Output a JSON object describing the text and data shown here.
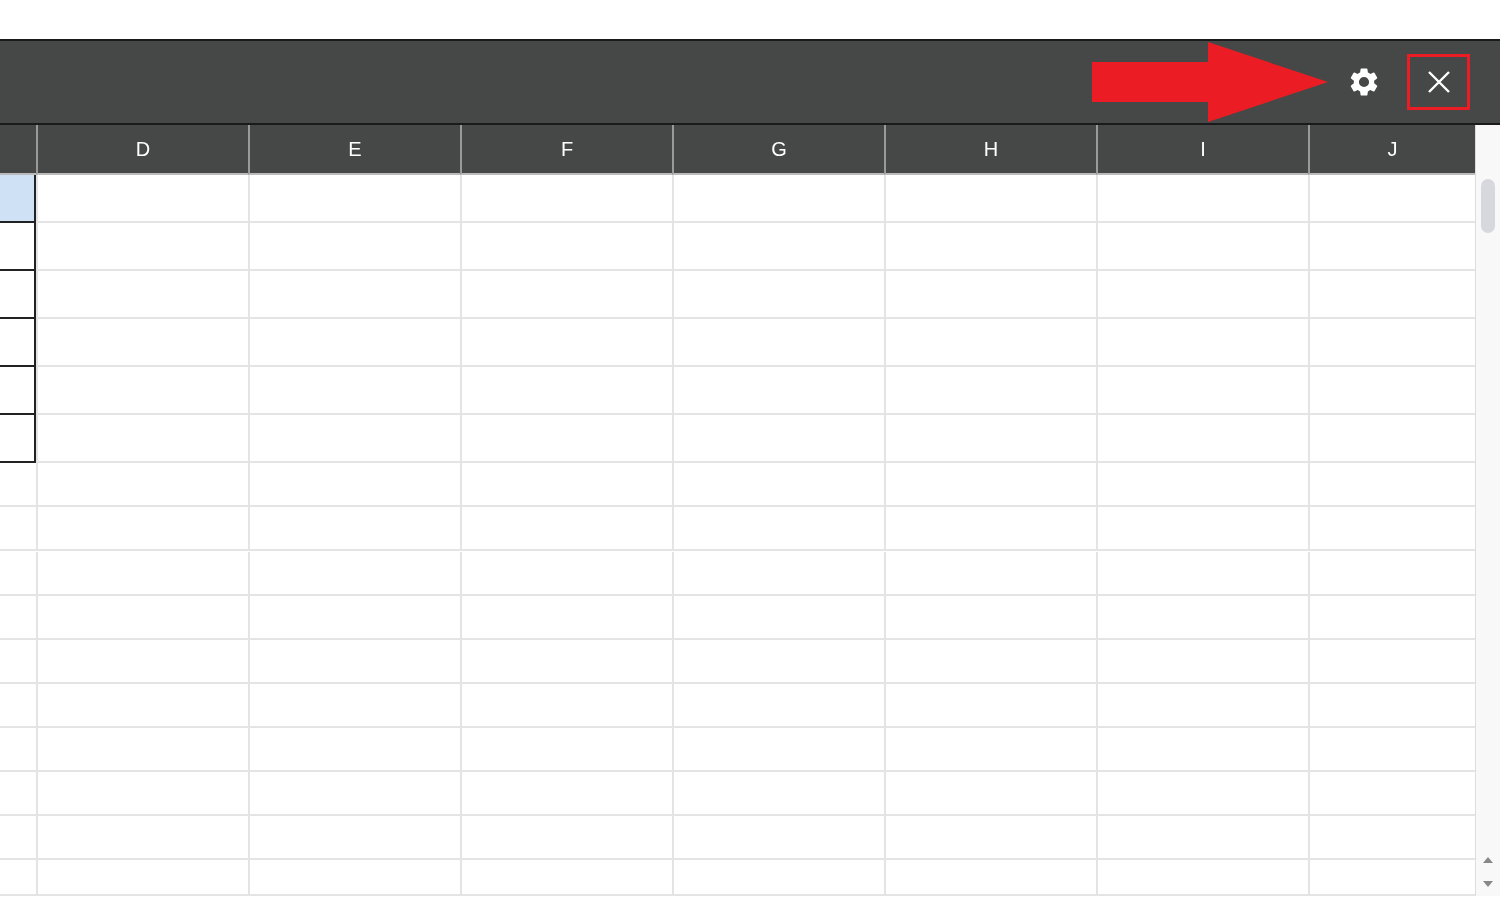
{
  "columns": [
    "D",
    "E",
    "F",
    "G",
    "H",
    "I",
    "J"
  ],
  "partial_column_cells": [
    {
      "selected": true,
      "bordered": true
    },
    {
      "selected": false,
      "bordered": true
    },
    {
      "selected": false,
      "bordered": true
    },
    {
      "selected": false,
      "bordered": true
    },
    {
      "selected": false,
      "bordered": true
    },
    {
      "selected": false,
      "bordered": true
    },
    {
      "selected": false,
      "bordered": false
    },
    {
      "selected": false,
      "bordered": false
    },
    {
      "selected": false,
      "bordered": false
    },
    {
      "selected": false,
      "bordered": false
    },
    {
      "selected": false,
      "bordered": false
    },
    {
      "selected": false,
      "bordered": false
    },
    {
      "selected": false,
      "bordered": false
    },
    {
      "selected": false,
      "bordered": false
    },
    {
      "selected": false,
      "bordered": false
    },
    {
      "selected": false,
      "bordered": false
    }
  ]
}
